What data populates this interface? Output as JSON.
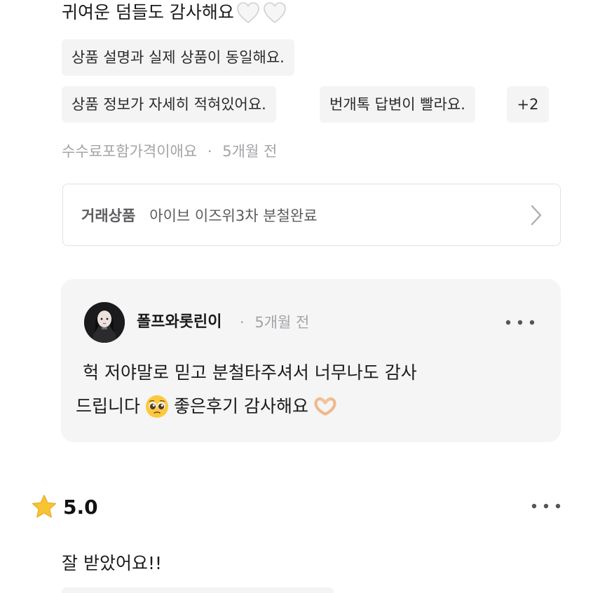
{
  "review1": {
    "text": "귀여운 덤들도 감사해요",
    "heart_icons": [
      "white-heart-icon",
      "white-heart-icon"
    ],
    "tags": [
      "상품 설명과 실제 상품이 동일해요.",
      "상품 정보가 자세히 적혀있어요.",
      "번개톡 답변이 빨라요."
    ],
    "more_tags": "+2",
    "reviewer": "수수료포함가격이애요",
    "separator": "·",
    "time": "5개월 전",
    "product": {
      "label": "거래상품",
      "name": "아이브 이즈위3차 분철완료"
    }
  },
  "reply": {
    "seller_name": "폴프와롯린이",
    "separator": "·",
    "time": "5개월 전",
    "line1": "헉 저야말로 믿고 분철타주셔서 너무나도 감사",
    "line2_a": "드립니다",
    "line2_b": "좋은후기 감사해요",
    "emojis": [
      "pleading-face",
      "heart-hands"
    ]
  },
  "review2": {
    "rating": "5.0",
    "text": "잘 받았어요!!"
  },
  "colors": {
    "tag_bg": "#f4f4f5",
    "meta_text": "#a4a4a8",
    "reply_bg": "#f5f5f6",
    "star": "#f7c531"
  }
}
